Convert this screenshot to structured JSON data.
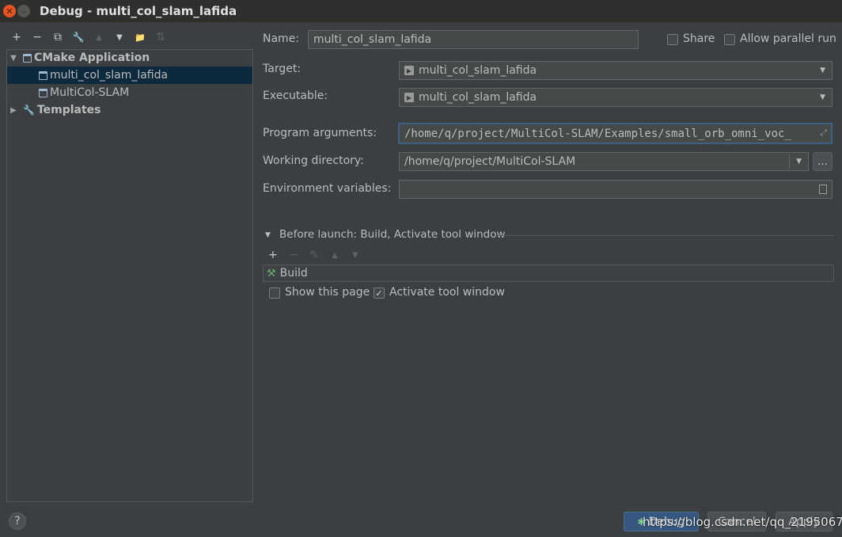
{
  "window": {
    "title": "Debug - multi_col_slam_lafida",
    "close_glyph": "✕",
    "minimize_glyph": "–"
  },
  "toolbar": {
    "add_glyph": "+",
    "remove_glyph": "−",
    "copy_glyph": "⧉",
    "edit_glyph": "🔧",
    "up_glyph": "▲",
    "down_glyph": "▼",
    "folder_glyph": "📁",
    "sort_glyph": "⇅"
  },
  "tree": {
    "groups": [
      {
        "label": "CMake Application",
        "expanded_glyph": "▼"
      },
      {
        "label": "Templates",
        "expanded_glyph": "▶"
      }
    ],
    "items": [
      {
        "label": "multi_col_slam_lafida",
        "selected": true
      },
      {
        "label": "MultiCol-SLAM",
        "selected": false
      }
    ]
  },
  "form": {
    "name_label": "Name:",
    "name_value": "multi_col_slam_lafida",
    "share_label": "Share",
    "parallel_label": "Allow parallel run",
    "target_label": "Target:",
    "target_value": "multi_col_slam_lafida",
    "executable_label": "Executable:",
    "executable_value": "multi_col_slam_lafida",
    "args_label": "Program arguments:",
    "args_value": "/home/q/project/MultiCol-SLAM/Examples/small_orb_omni_voc_",
    "workdir_label": "Working directory:",
    "workdir_value": "/home/q/project/MultiCol-SLAM",
    "browse_label": "...",
    "env_label": "Environment variables:",
    "env_value": ""
  },
  "before_launch": {
    "header": "Before launch: Build, Activate tool window",
    "toolbar": {
      "add": "+",
      "remove": "−",
      "edit": "✎",
      "up": "▲",
      "down": "▼"
    },
    "items": [
      {
        "label": "Build",
        "icon": "hammer-icon"
      }
    ],
    "show_page_label": "Show this page",
    "show_page_checked": false,
    "activate_label": "Activate tool window",
    "activate_checked": true
  },
  "buttons": {
    "help": "?",
    "debug": "Debug",
    "cancel": "Cancel",
    "apply": "Apply"
  },
  "watermark": "https://blog.csdn.net/qq_21950671",
  "colors": {
    "background": "#3c3f41",
    "selection": "#0d293e",
    "accent": "#3d6185",
    "close": "#e95420"
  }
}
